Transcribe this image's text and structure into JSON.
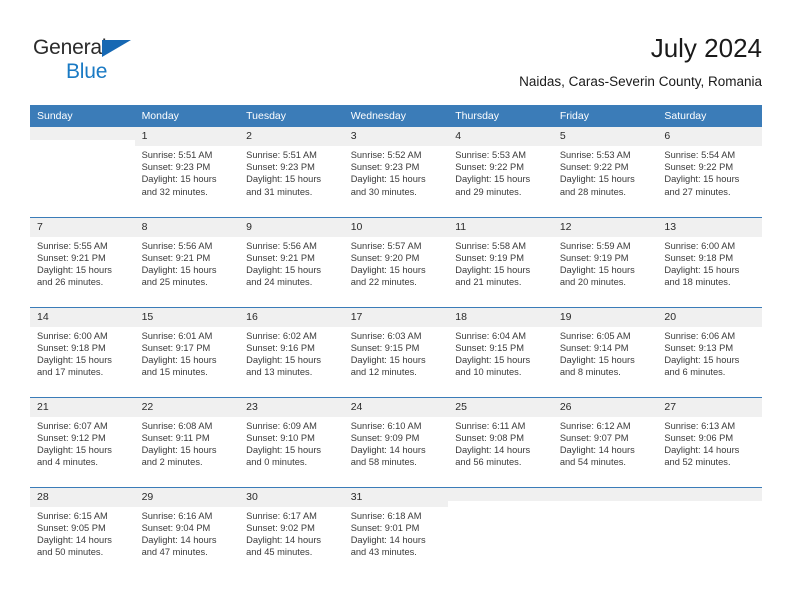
{
  "brand": {
    "line1": "General",
    "line2": "Blue",
    "triangle_color": "#1668b3",
    "blue_color": "#1a7ac4"
  },
  "header": {
    "title": "July 2024",
    "subtitle": "Naidas, Caras-Severin County, Romania"
  },
  "theme": {
    "header_blue": "#3b7cb8",
    "daynum_bg": "#f0f0f0",
    "text": "#3a3a3a"
  },
  "weekday_headers": [
    "Sunday",
    "Monday",
    "Tuesday",
    "Wednesday",
    "Thursday",
    "Friday",
    "Saturday"
  ],
  "labels": {
    "sunrise_prefix": "Sunrise:",
    "sunset_prefix": "Sunset:",
    "daylight_prefix": "Daylight:"
  },
  "weeks": [
    [
      {
        "day": "",
        "sunrise": "",
        "sunset": "",
        "daylight_line1": "",
        "daylight_line2": ""
      },
      {
        "day": "1",
        "sunrise": "Sunrise: 5:51 AM",
        "sunset": "Sunset: 9:23 PM",
        "daylight_line1": "Daylight: 15 hours",
        "daylight_line2": "and 32 minutes."
      },
      {
        "day": "2",
        "sunrise": "Sunrise: 5:51 AM",
        "sunset": "Sunset: 9:23 PM",
        "daylight_line1": "Daylight: 15 hours",
        "daylight_line2": "and 31 minutes."
      },
      {
        "day": "3",
        "sunrise": "Sunrise: 5:52 AM",
        "sunset": "Sunset: 9:23 PM",
        "daylight_line1": "Daylight: 15 hours",
        "daylight_line2": "and 30 minutes."
      },
      {
        "day": "4",
        "sunrise": "Sunrise: 5:53 AM",
        "sunset": "Sunset: 9:22 PM",
        "daylight_line1": "Daylight: 15 hours",
        "daylight_line2": "and 29 minutes."
      },
      {
        "day": "5",
        "sunrise": "Sunrise: 5:53 AM",
        "sunset": "Sunset: 9:22 PM",
        "daylight_line1": "Daylight: 15 hours",
        "daylight_line2": "and 28 minutes."
      },
      {
        "day": "6",
        "sunrise": "Sunrise: 5:54 AM",
        "sunset": "Sunset: 9:22 PM",
        "daylight_line1": "Daylight: 15 hours",
        "daylight_line2": "and 27 minutes."
      }
    ],
    [
      {
        "day": "7",
        "sunrise": "Sunrise: 5:55 AM",
        "sunset": "Sunset: 9:21 PM",
        "daylight_line1": "Daylight: 15 hours",
        "daylight_line2": "and 26 minutes."
      },
      {
        "day": "8",
        "sunrise": "Sunrise: 5:56 AM",
        "sunset": "Sunset: 9:21 PM",
        "daylight_line1": "Daylight: 15 hours",
        "daylight_line2": "and 25 minutes."
      },
      {
        "day": "9",
        "sunrise": "Sunrise: 5:56 AM",
        "sunset": "Sunset: 9:21 PM",
        "daylight_line1": "Daylight: 15 hours",
        "daylight_line2": "and 24 minutes."
      },
      {
        "day": "10",
        "sunrise": "Sunrise: 5:57 AM",
        "sunset": "Sunset: 9:20 PM",
        "daylight_line1": "Daylight: 15 hours",
        "daylight_line2": "and 22 minutes."
      },
      {
        "day": "11",
        "sunrise": "Sunrise: 5:58 AM",
        "sunset": "Sunset: 9:19 PM",
        "daylight_line1": "Daylight: 15 hours",
        "daylight_line2": "and 21 minutes."
      },
      {
        "day": "12",
        "sunrise": "Sunrise: 5:59 AM",
        "sunset": "Sunset: 9:19 PM",
        "daylight_line1": "Daylight: 15 hours",
        "daylight_line2": "and 20 minutes."
      },
      {
        "day": "13",
        "sunrise": "Sunrise: 6:00 AM",
        "sunset": "Sunset: 9:18 PM",
        "daylight_line1": "Daylight: 15 hours",
        "daylight_line2": "and 18 minutes."
      }
    ],
    [
      {
        "day": "14",
        "sunrise": "Sunrise: 6:00 AM",
        "sunset": "Sunset: 9:18 PM",
        "daylight_line1": "Daylight: 15 hours",
        "daylight_line2": "and 17 minutes."
      },
      {
        "day": "15",
        "sunrise": "Sunrise: 6:01 AM",
        "sunset": "Sunset: 9:17 PM",
        "daylight_line1": "Daylight: 15 hours",
        "daylight_line2": "and 15 minutes."
      },
      {
        "day": "16",
        "sunrise": "Sunrise: 6:02 AM",
        "sunset": "Sunset: 9:16 PM",
        "daylight_line1": "Daylight: 15 hours",
        "daylight_line2": "and 13 minutes."
      },
      {
        "day": "17",
        "sunrise": "Sunrise: 6:03 AM",
        "sunset": "Sunset: 9:15 PM",
        "daylight_line1": "Daylight: 15 hours",
        "daylight_line2": "and 12 minutes."
      },
      {
        "day": "18",
        "sunrise": "Sunrise: 6:04 AM",
        "sunset": "Sunset: 9:15 PM",
        "daylight_line1": "Daylight: 15 hours",
        "daylight_line2": "and 10 minutes."
      },
      {
        "day": "19",
        "sunrise": "Sunrise: 6:05 AM",
        "sunset": "Sunset: 9:14 PM",
        "daylight_line1": "Daylight: 15 hours",
        "daylight_line2": "and 8 minutes."
      },
      {
        "day": "20",
        "sunrise": "Sunrise: 6:06 AM",
        "sunset": "Sunset: 9:13 PM",
        "daylight_line1": "Daylight: 15 hours",
        "daylight_line2": "and 6 minutes."
      }
    ],
    [
      {
        "day": "21",
        "sunrise": "Sunrise: 6:07 AM",
        "sunset": "Sunset: 9:12 PM",
        "daylight_line1": "Daylight: 15 hours",
        "daylight_line2": "and 4 minutes."
      },
      {
        "day": "22",
        "sunrise": "Sunrise: 6:08 AM",
        "sunset": "Sunset: 9:11 PM",
        "daylight_line1": "Daylight: 15 hours",
        "daylight_line2": "and 2 minutes."
      },
      {
        "day": "23",
        "sunrise": "Sunrise: 6:09 AM",
        "sunset": "Sunset: 9:10 PM",
        "daylight_line1": "Daylight: 15 hours",
        "daylight_line2": "and 0 minutes."
      },
      {
        "day": "24",
        "sunrise": "Sunrise: 6:10 AM",
        "sunset": "Sunset: 9:09 PM",
        "daylight_line1": "Daylight: 14 hours",
        "daylight_line2": "and 58 minutes."
      },
      {
        "day": "25",
        "sunrise": "Sunrise: 6:11 AM",
        "sunset": "Sunset: 9:08 PM",
        "daylight_line1": "Daylight: 14 hours",
        "daylight_line2": "and 56 minutes."
      },
      {
        "day": "26",
        "sunrise": "Sunrise: 6:12 AM",
        "sunset": "Sunset: 9:07 PM",
        "daylight_line1": "Daylight: 14 hours",
        "daylight_line2": "and 54 minutes."
      },
      {
        "day": "27",
        "sunrise": "Sunrise: 6:13 AM",
        "sunset": "Sunset: 9:06 PM",
        "daylight_line1": "Daylight: 14 hours",
        "daylight_line2": "and 52 minutes."
      }
    ],
    [
      {
        "day": "28",
        "sunrise": "Sunrise: 6:15 AM",
        "sunset": "Sunset: 9:05 PM",
        "daylight_line1": "Daylight: 14 hours",
        "daylight_line2": "and 50 minutes."
      },
      {
        "day": "29",
        "sunrise": "Sunrise: 6:16 AM",
        "sunset": "Sunset: 9:04 PM",
        "daylight_line1": "Daylight: 14 hours",
        "daylight_line2": "and 47 minutes."
      },
      {
        "day": "30",
        "sunrise": "Sunrise: 6:17 AM",
        "sunset": "Sunset: 9:02 PM",
        "daylight_line1": "Daylight: 14 hours",
        "daylight_line2": "and 45 minutes."
      },
      {
        "day": "31",
        "sunrise": "Sunrise: 6:18 AM",
        "sunset": "Sunset: 9:01 PM",
        "daylight_line1": "Daylight: 14 hours",
        "daylight_line2": "and 43 minutes."
      },
      {
        "day": "",
        "sunrise": "",
        "sunset": "",
        "daylight_line1": "",
        "daylight_line2": ""
      },
      {
        "day": "",
        "sunrise": "",
        "sunset": "",
        "daylight_line1": "",
        "daylight_line2": ""
      },
      {
        "day": "",
        "sunrise": "",
        "sunset": "",
        "daylight_line1": "",
        "daylight_line2": ""
      }
    ]
  ]
}
